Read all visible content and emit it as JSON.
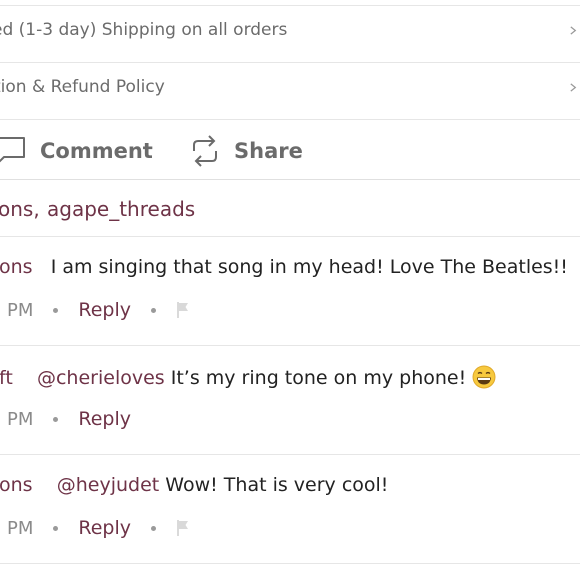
{
  "info_rows": [
    {
      "text": "ed (1-3 day) Shipping on all orders"
    },
    {
      "text": "tion & Refund Policy"
    }
  ],
  "actions": {
    "comment_label": "Comment",
    "share_label": "Share"
  },
  "likes": {
    "prefix": "ons,",
    "user": "agape_threads"
  },
  "comments": [
    {
      "user": "ons",
      "mention": "",
      "text": "I am singing that song in my head! Love The Beatles!!",
      "time": "PM",
      "reply": "Reply",
      "has_flag": true
    },
    {
      "user": "ft",
      "mention": "@cherieloves",
      "text": "It’s my ring tone on my phone!",
      "time": "PM",
      "reply": "Reply",
      "has_flag": false,
      "emoji": "grinning-face-emoji"
    },
    {
      "user": "ons",
      "mention": "@heyjudet",
      "text": "Wow! That is very cool!",
      "time": "PM",
      "reply": "Reply",
      "has_flag": true
    }
  ],
  "colors": {
    "accent": "#6e3347",
    "muted": "#6b6b6b",
    "divider": "#e6e6e6"
  },
  "icons": [
    "chevron-right-icon",
    "comment-bubble-icon",
    "share-repost-icon",
    "flag-icon"
  ]
}
